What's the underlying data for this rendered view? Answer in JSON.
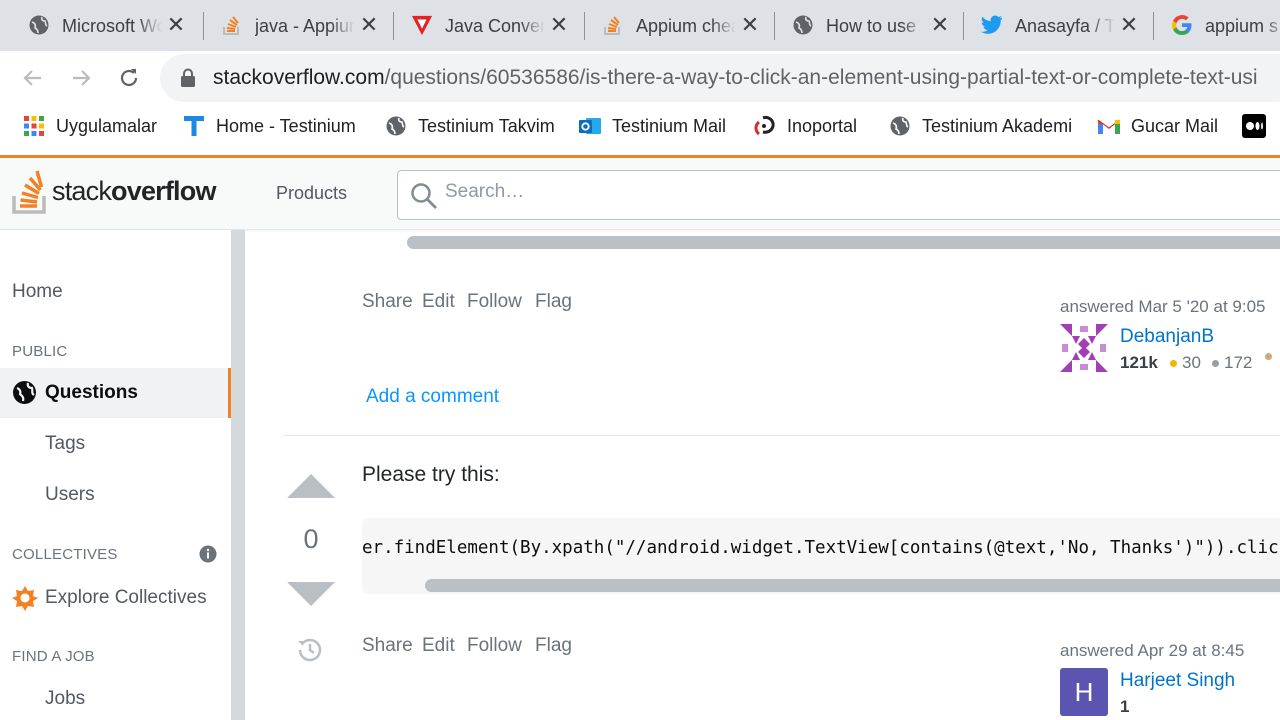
{
  "browser": {
    "tabs": [
      {
        "title": "Microsoft Word",
        "icon": "globe-icon"
      },
      {
        "title": "java - Appium",
        "icon": "stackoverflow-icon"
      },
      {
        "title": "Java Converter",
        "icon": "red-v-icon"
      },
      {
        "title": "Appium cheat",
        "icon": "stackoverflow-icon"
      },
      {
        "title": "How to use",
        "icon": "globe-icon"
      },
      {
        "title": "Anasayfa / Twitter",
        "icon": "twitter-icon"
      },
      {
        "title": "appium s",
        "icon": "google-icon"
      }
    ],
    "url_host": "stackoverflow.com",
    "url_path": "/questions/60536586/is-there-a-way-to-click-an-element-using-partial-text-or-complete-text-usi",
    "bookmarks": [
      {
        "label": "Uygulamalar",
        "icon": "apps-grid-icon"
      },
      {
        "label": "Home - Testinium",
        "icon": "testinium-icon"
      },
      {
        "label": "Testinium Takvim",
        "icon": "globe-icon"
      },
      {
        "label": "Testinium Mail",
        "icon": "outlook-icon"
      },
      {
        "label": "Inoportal",
        "icon": "inoportal-icon"
      },
      {
        "label": "Testinium Akademi",
        "icon": "globe-icon"
      },
      {
        "label": "Gucar Mail",
        "icon": "gmail-icon"
      }
    ]
  },
  "so": {
    "logo_light": "stack",
    "logo_bold": "overflow",
    "products": "Products",
    "search_placeholder": "Search…",
    "sidebar": {
      "home": "Home",
      "public_head": "PUBLIC",
      "questions": "Questions",
      "tags": "Tags",
      "users": "Users",
      "collectives_head": "COLLECTIVES",
      "explore_collectives": "Explore Collectives",
      "find_job_head": "FIND A JOB",
      "jobs": "Jobs"
    },
    "answer1": {
      "menu": {
        "share": "Share",
        "edit": "Edit",
        "follow": "Follow",
        "flag": "Flag"
      },
      "answered": "answered Mar 5 '20 at 9:05",
      "user": "DebanjanB",
      "rep": "121k",
      "gold": "30",
      "silver": "172",
      "add_comment": "Add a comment"
    },
    "answer2": {
      "votes": "0",
      "text": "Please try this:",
      "code": "er.findElement(By.xpath(\"//android.widget.TextView[contains(@text,'No, Thanks')\")).clic",
      "menu": {
        "share": "Share",
        "edit": "Edit",
        "follow": "Follow",
        "flag": "Flag"
      },
      "answered": "answered Apr 29 at 8:45",
      "user": "Harjeet Singh",
      "rep": "1",
      "avatar_letter": "H"
    }
  },
  "colors": {
    "so_orange": "#f48024",
    "link_blue": "#0074cc",
    "gold": "#f1b600",
    "silver": "#9a9ea3",
    "bronze": "#d1a684"
  }
}
